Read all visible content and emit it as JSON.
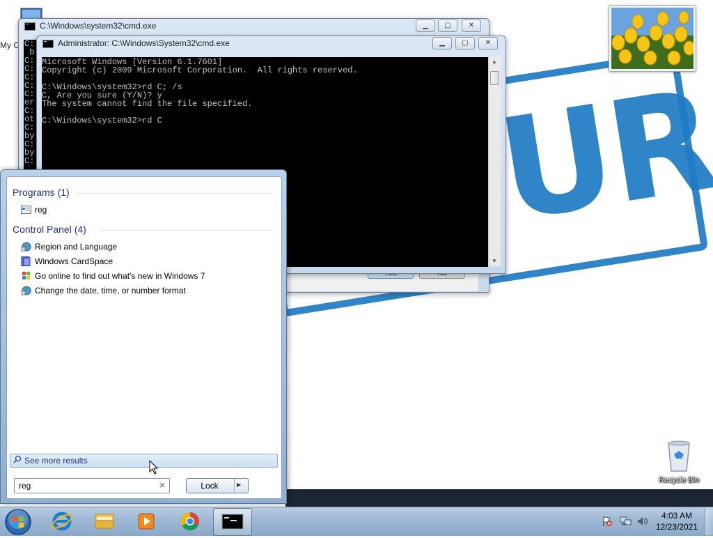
{
  "desktop": {
    "top_icon_label": "My C",
    "recycle_bin_label": "Recycle Bin",
    "stamp_text": "OURG",
    "stamp_color": "#1e7bc4"
  },
  "cmd_back": {
    "title": "C:\\Windows\\system32\\cmd.exe",
    "console_edge": "C:\n b\nC:\nC:\nC:\nC:\nC:\ner\nC:\not\nC:\nby\nC:\nby\nC:\n"
  },
  "cmd_front": {
    "title": "Administrator: C:\\Windows\\System32\\cmd.exe",
    "console_text": "Microsoft Windows [Version 6.1.7601]\nCopyright (c) 2009 Microsoft Corporation.  All rights reserved.\n\nC:\\Windows\\system32>rd C; /s\nC, Are you sure (Y/N)? y\nThe system cannot find the file specified.\n\nC:\\Windows\\system32>rd C"
  },
  "dialog": {
    "yes_label": "Yes",
    "no_label": "No"
  },
  "start_menu": {
    "programs_header": "Programs (1)",
    "programs": [
      {
        "label": "reg",
        "icon": "registry-editor-icon"
      }
    ],
    "control_panel_header": "Control Panel (4)",
    "control_panel": [
      {
        "label": "Region and Language",
        "icon": "globe-icon"
      },
      {
        "label": "Windows CardSpace",
        "icon": "cardspace-icon"
      },
      {
        "label": "Go online to find out what's new in Windows 7",
        "icon": "windows-flag-icon"
      },
      {
        "label": "Change the date, time, or number format",
        "icon": "globe-icon"
      }
    ],
    "see_more": "See more results",
    "search_value": "reg",
    "clear_glyph": "×",
    "lock_label": "Lock",
    "lock_arrow": "▶"
  },
  "taskbar": {
    "time": "4:03 AM",
    "date": "12/23/2021",
    "apps": [
      "start-orb",
      "internet-explorer",
      "windows-explorer",
      "media-player",
      "chrome",
      "cmd"
    ],
    "tray": [
      "action-center-flag-icon",
      "network-icon",
      "volume-icon"
    ]
  },
  "colors": {
    "taskbar": "#9db8d4",
    "console_bg": "#000000",
    "console_fg": "#c0c0c0",
    "menu_header": "#1e3287"
  }
}
